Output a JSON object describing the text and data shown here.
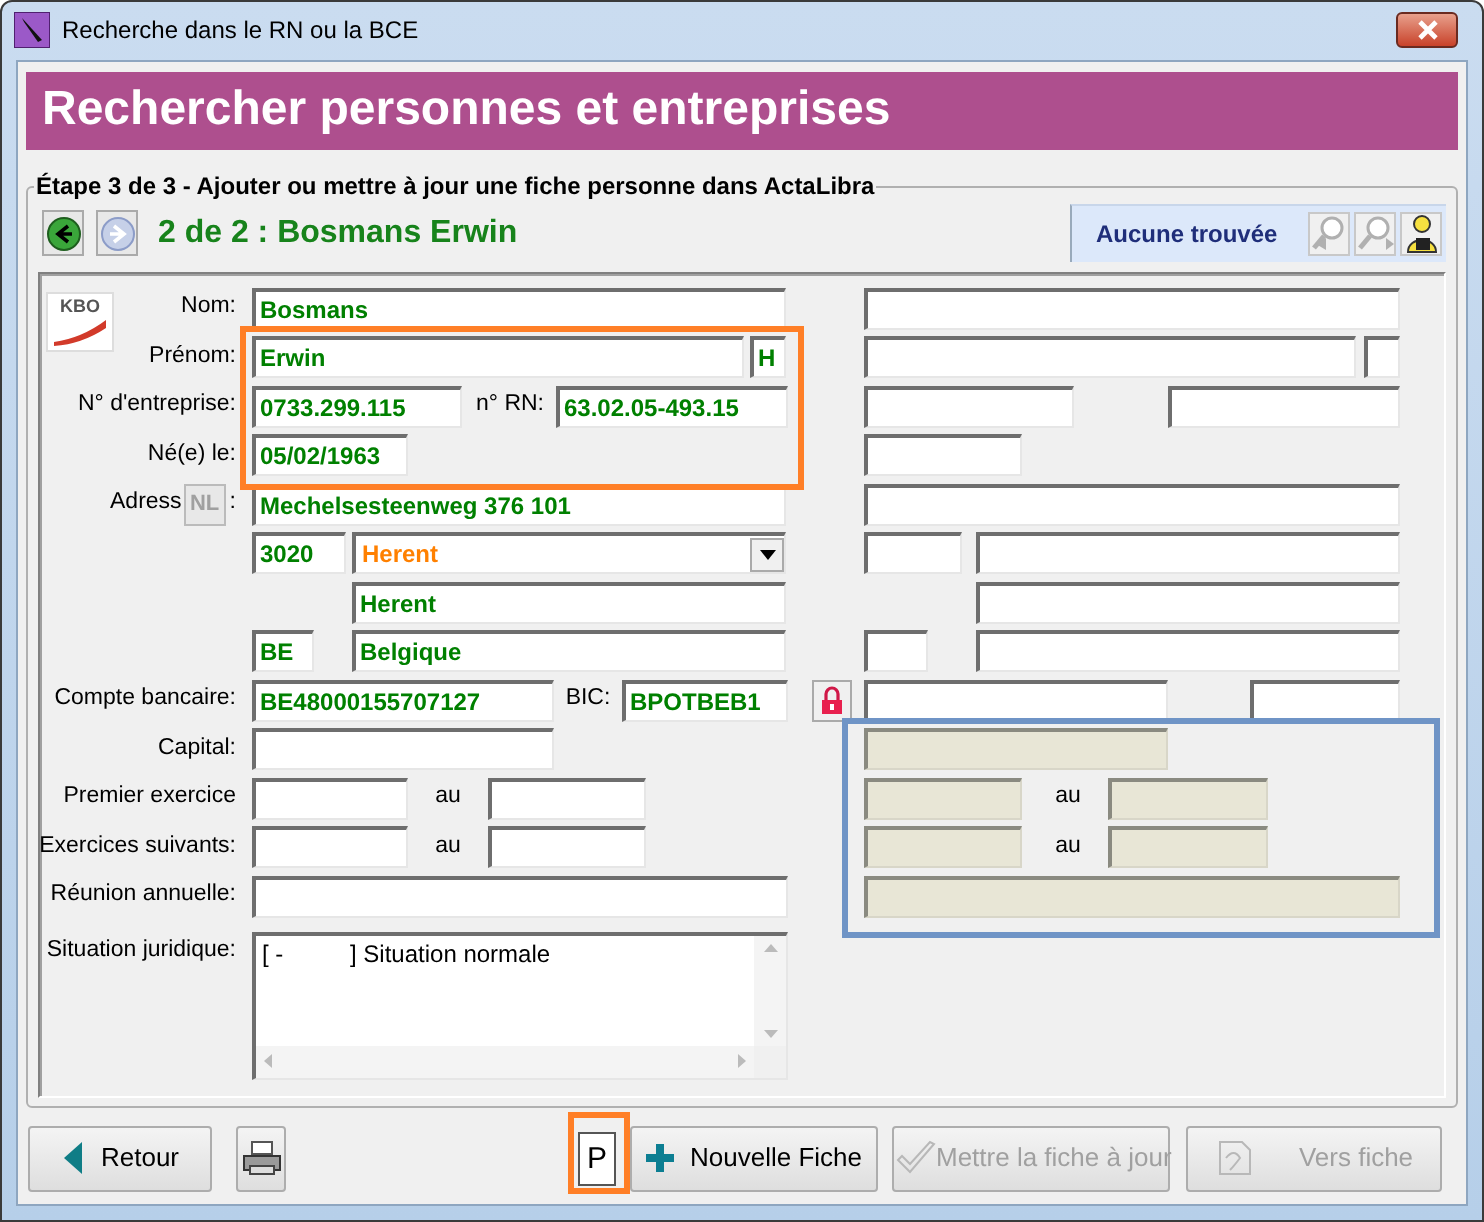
{
  "window": {
    "title": "Recherche dans le RN ou la BCE"
  },
  "header": {
    "title": "Rechercher personnes et entreprises"
  },
  "step": {
    "legend": "Étape 3 de 3 - Ajouter ou mettre à jour une fiche personne dans ActaLibra"
  },
  "navigation": {
    "buttons": [
      {
        "kind": "back",
        "disabled": false
      },
      {
        "kind": "forward",
        "disabled": true
      }
    ],
    "record": "2 de 2 : Bosmans Erwin"
  },
  "search_status": {
    "text": "Aucune trouvée",
    "tools": [
      {
        "kind": "search_prev",
        "disabled": true
      },
      {
        "kind": "search_next",
        "disabled": true
      },
      {
        "kind": "user_lock",
        "disabled": false
      }
    ]
  },
  "logo": {
    "text": "KBO"
  },
  "rows": [
    {
      "label": "Nom:",
      "items": [
        {
          "kind": "field",
          "value": "Bosmans",
          "color": "#008000"
        },
        {
          "kind": "field",
          "disabled": false
        }
      ]
    },
    {
      "label": "Prénom:",
      "items": [
        {
          "kind": "field",
          "value": "Erwin",
          "color": "#008000"
        },
        {
          "kind": "field",
          "value": "H",
          "color": "#008000"
        },
        {
          "kind": "field",
          "disabled": false
        },
        {
          "kind": "field",
          "disabled": false
        }
      ]
    },
    {
      "label": "N° d'entreprise:",
      "items": [
        {
          "kind": "field",
          "value": "0733.299.115",
          "color": "#008000"
        },
        {
          "kind": "text",
          "text": "n° RN:"
        },
        {
          "kind": "field",
          "value": "63.02.05-493.15",
          "color": "#008000"
        },
        {
          "kind": "field",
          "disabled": false
        },
        {
          "kind": "field",
          "disabled": false
        }
      ]
    },
    {
      "label": "Né(e) le:",
      "items": [
        {
          "kind": "field",
          "value": "05/02/1963",
          "color": "#008000"
        },
        {
          "kind": "field",
          "disabled": false
        }
      ]
    },
    {
      "label": "Adress",
      "label_button": {
        "text": "NL",
        "disabled": true
      },
      "label_suffix": ":",
      "items": [
        {
          "kind": "field",
          "value": "Mechelsesteenweg 376 101",
          "color": "#008000"
        },
        {
          "kind": "field",
          "disabled": false
        }
      ]
    },
    {
      "items": [
        {
          "kind": "field",
          "value": "3020",
          "color": "#008000"
        },
        {
          "kind": "combo",
          "value": "Herent",
          "color": "#ff8000"
        },
        {
          "kind": "field",
          "disabled": false
        },
        {
          "kind": "field",
          "disabled": false
        }
      ]
    },
    {
      "items": [
        {
          "kind": "field",
          "value": "Herent",
          "color": "#008000"
        },
        {
          "kind": "field",
          "disabled": false
        }
      ]
    },
    {
      "items": [
        {
          "kind": "field",
          "value": "BE",
          "color": "#008000"
        },
        {
          "kind": "field",
          "value": "Belgique",
          "color": "#008000"
        },
        {
          "kind": "field",
          "disabled": false
        },
        {
          "kind": "field",
          "disabled": false
        }
      ]
    },
    {
      "label": "Compte bancaire:",
      "items": [
        {
          "kind": "field",
          "value": "BE48000155707127",
          "color": "#008000"
        },
        {
          "kind": "text",
          "text": "BIC:"
        },
        {
          "kind": "field",
          "value": "BPOTBEB1",
          "color": "#008000"
        },
        {
          "kind": "lock"
        },
        {
          "kind": "field",
          "disabled": false
        },
        {
          "kind": "field",
          "disabled": false
        }
      ]
    },
    {
      "label": "Capital:",
      "items": [
        {
          "kind": "field",
          "disabled": false
        },
        {
          "kind": "field",
          "disabled": true
        }
      ]
    },
    {
      "label": "Premier exercice",
      "items": [
        {
          "kind": "field",
          "disabled": false
        },
        {
          "kind": "text",
          "text": "au"
        },
        {
          "kind": "field",
          "disabled": false
        },
        {
          "kind": "field",
          "disabled": true
        },
        {
          "kind": "text",
          "text": "au"
        },
        {
          "kind": "field",
          "disabled": true
        }
      ]
    },
    {
      "label": "Exercices suivants:",
      "items": [
        {
          "kind": "field",
          "disabled": false
        },
        {
          "kind": "text",
          "text": "au"
        },
        {
          "kind": "field",
          "disabled": false
        },
        {
          "kind": "field",
          "disabled": true
        },
        {
          "kind": "text",
          "text": "au"
        },
        {
          "kind": "field",
          "disabled": true
        }
      ]
    },
    {
      "label": "Réunion annuelle:",
      "items": [
        {
          "kind": "field",
          "disabled": false
        },
        {
          "kind": "field",
          "disabled": true
        }
      ]
    },
    {
      "label": "Situation juridique:",
      "items": [
        {
          "kind": "memo",
          "value": "[ -          ] Situation normale"
        }
      ]
    }
  ],
  "highlights": [
    {
      "color": "#ff7f27"
    },
    {
      "color": "#6f94c6"
    },
    {
      "color": "#ff7f27"
    }
  ],
  "footer": {
    "buttons": [
      {
        "kind": "back",
        "label": "Retour",
        "disabled": false
      },
      {
        "kind": "print",
        "disabled": false
      },
      {
        "kind": "input",
        "value": "P"
      },
      {
        "kind": "new",
        "label": "Nouvelle Fiche",
        "disabled": false
      },
      {
        "kind": "update",
        "label": "Mettre la fiche à jour",
        "disabled": true
      },
      {
        "kind": "open",
        "label": "Vers fiche",
        "disabled": true
      }
    ]
  }
}
